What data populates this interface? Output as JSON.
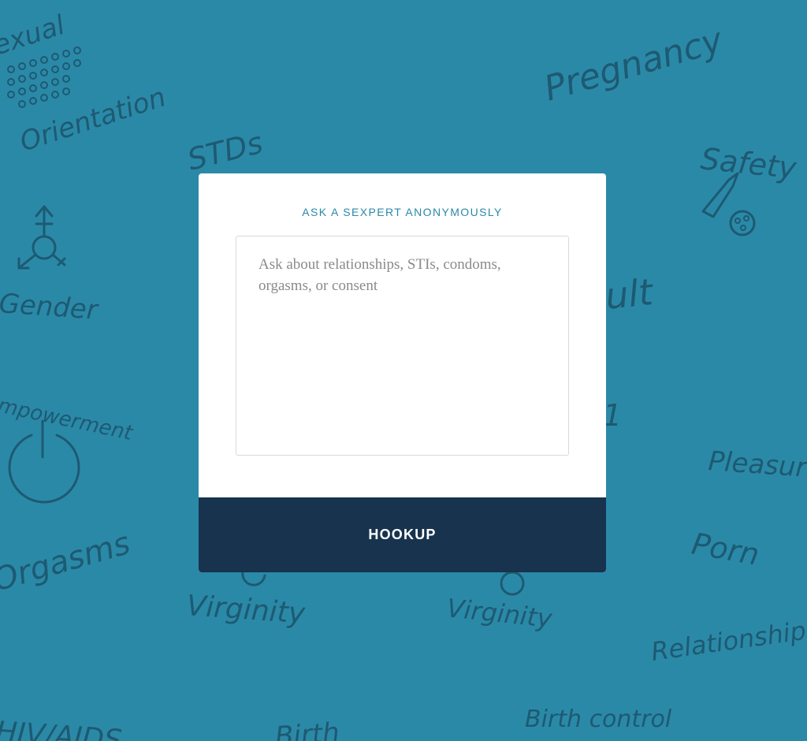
{
  "background": {
    "color": "#2b89a8",
    "doodle_color": "#1d5a72",
    "words": {
      "sexual_orientation_top": "exual",
      "sexual_orientation_bottom": "Orientation",
      "pregnancy": "Pregnancy",
      "stds": "STDs",
      "safety": "Safety",
      "gender": "Gender",
      "assault_fragment": "ult",
      "empowerment": "mpowerment",
      "fragment_m": "1",
      "pleasure": "Pleasur",
      "porn": "Porn",
      "orgasms": "Orgasms",
      "virginity_left": "Virginity",
      "virginity_right": "Virginity",
      "relationships": "Relationship",
      "hiv_aids": "HIV/AIDS",
      "birth_fragment": "Birth",
      "birth_control": "Birth control"
    }
  },
  "modal": {
    "heading": "ASK A SEXPERT ANONYMOUSLY",
    "question_value": "",
    "question_placeholder": "Ask about relationships, STIs, condoms, orgasms, or consent",
    "submit_label": "HOOKUP",
    "accent_color": "#2b89a8",
    "button_color": "#17334d"
  }
}
